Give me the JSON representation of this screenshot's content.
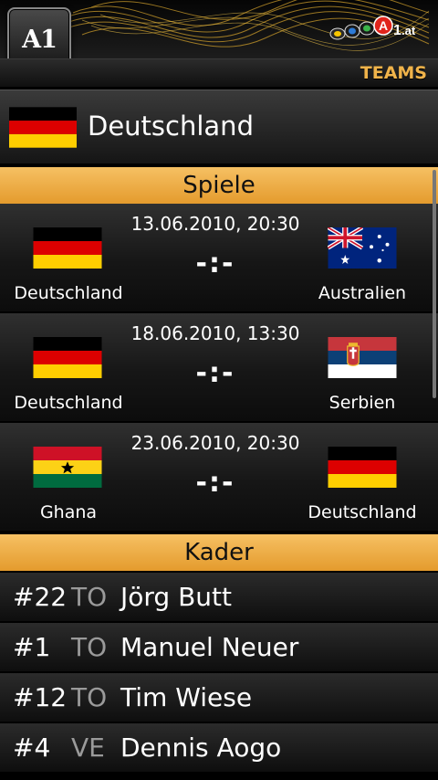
{
  "header": {
    "logo_text": "A1",
    "brand_text": "LOLA1.at",
    "section_title": "TEAMS"
  },
  "team": {
    "name": "Deutschland",
    "flag": "germany-flag"
  },
  "matches_title": "Spiele",
  "matches": [
    {
      "date": "13.06.2010, 20:30",
      "score": "-:-",
      "home": "Deutschland",
      "home_flag": "germany-flag",
      "away": "Australien",
      "away_flag": "australia-flag"
    },
    {
      "date": "18.06.2010, 13:30",
      "score": "-:-",
      "home": "Deutschland",
      "home_flag": "germany-flag",
      "away": "Serbien",
      "away_flag": "serbia-flag"
    },
    {
      "date": "23.06.2010, 20:30",
      "score": "-:-",
      "home": "Ghana",
      "home_flag": "ghana-flag",
      "away": "Deutschland",
      "away_flag": "germany-flag"
    }
  ],
  "squad_title": "Kader",
  "squad": [
    {
      "number": "#22",
      "position": "TO",
      "name": "Jörg Butt"
    },
    {
      "number": "#1",
      "position": "TO",
      "name": "Manuel Neuer"
    },
    {
      "number": "#12",
      "position": "TO",
      "name": "Tim Wiese"
    },
    {
      "number": "#4",
      "position": "VE",
      "name": "Dennis Aogo"
    }
  ],
  "colors": {
    "accent": "#f0b34a",
    "section_bar": "#eead44"
  }
}
